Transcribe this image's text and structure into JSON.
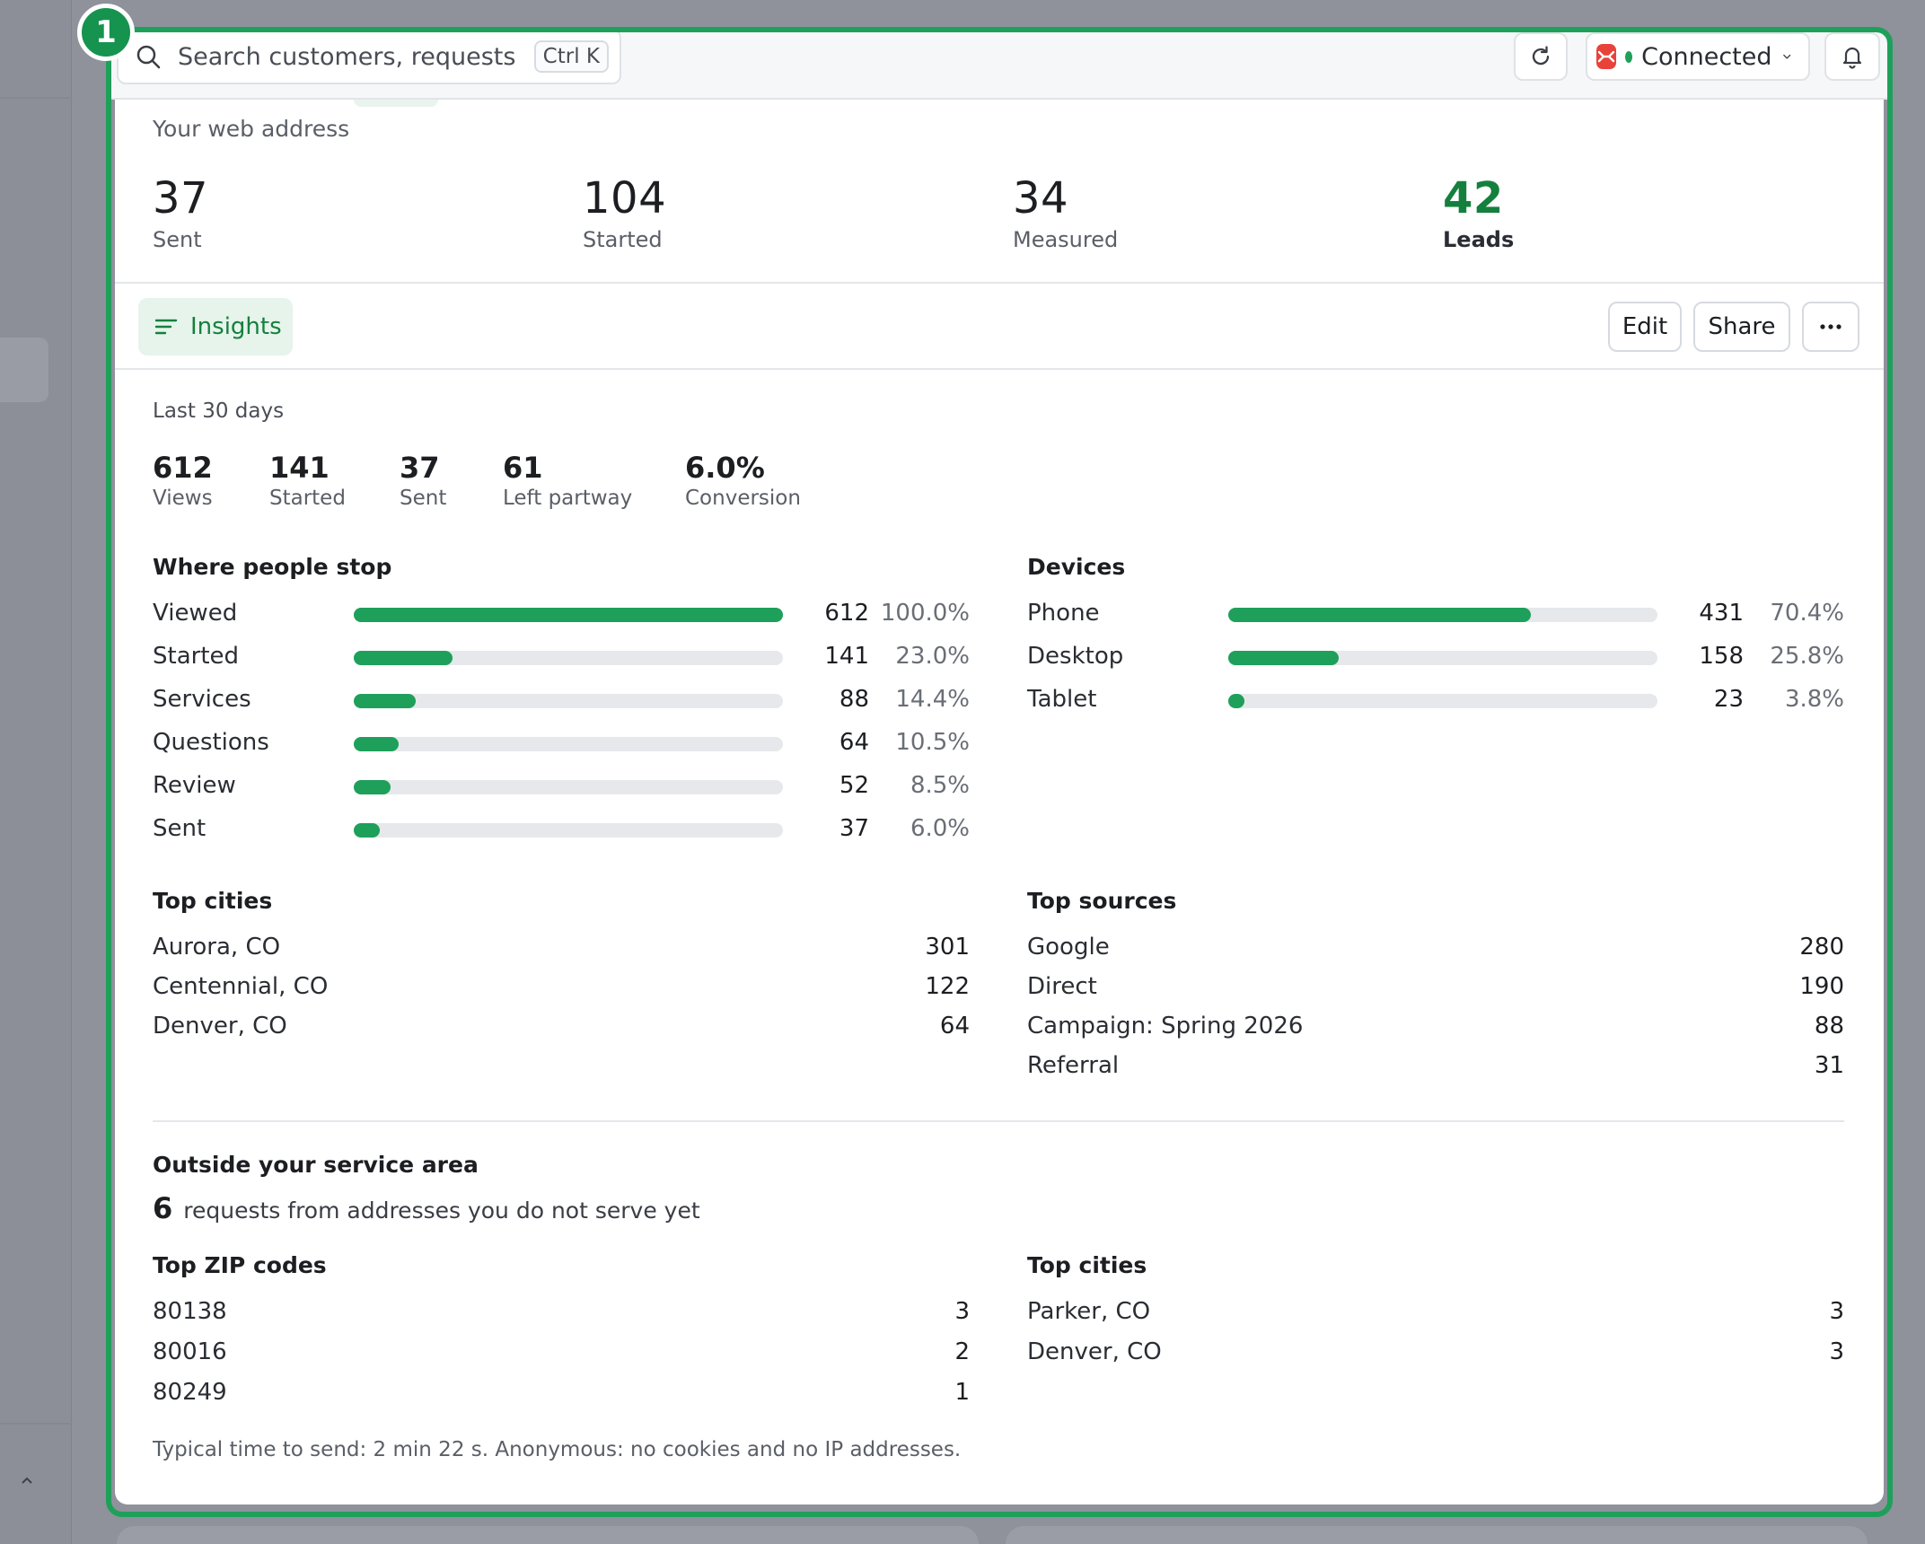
{
  "colors": {
    "accent": "#1ea05a",
    "accent_dark": "#15803d",
    "highlight_frame": "#1ea05a",
    "status_connected": "#1ea05a",
    "integration_logo": "#e8423a"
  },
  "overlay": {
    "badge_number": "1"
  },
  "topbar": {
    "search_placeholder": "Search customers, requests",
    "search_shortcut": "Ctrl K",
    "refresh_icon": "refresh-icon",
    "connection_status": "Connected",
    "bell_icon": "bell-icon"
  },
  "summary": {
    "label": "Your web address",
    "kpis": [
      {
        "value": "37",
        "label": "Sent"
      },
      {
        "value": "104",
        "label": "Started"
      },
      {
        "value": "34",
        "label": "Measured"
      },
      {
        "value": "42",
        "label": "Leads"
      }
    ]
  },
  "tabs": {
    "active": "Insights",
    "edit": "Edit",
    "share": "Share",
    "more": "···"
  },
  "insights": {
    "period": "Last 30 days",
    "stats": [
      {
        "value": "612",
        "label": "Views"
      },
      {
        "value": "141",
        "label": "Started"
      },
      {
        "value": "37",
        "label": "Sent"
      },
      {
        "value": "61",
        "label": "Left partway"
      },
      {
        "value": "6.0%",
        "label": "Conversion"
      }
    ],
    "where_people_stop": {
      "title": "Where people stop",
      "rows": [
        {
          "label": "Viewed",
          "count": "612",
          "pct": "100.0%",
          "fraction": 1.0
        },
        {
          "label": "Started",
          "count": "141",
          "pct": "23.0%",
          "fraction": 0.23
        },
        {
          "label": "Services",
          "count": "88",
          "pct": "14.4%",
          "fraction": 0.144
        },
        {
          "label": "Questions",
          "count": "64",
          "pct": "10.5%",
          "fraction": 0.105
        },
        {
          "label": "Review",
          "count": "52",
          "pct": "8.5%",
          "fraction": 0.085
        },
        {
          "label": "Sent",
          "count": "37",
          "pct": "6.0%",
          "fraction": 0.06
        }
      ]
    },
    "devices": {
      "title": "Devices",
      "rows": [
        {
          "label": "Phone",
          "count": "431",
          "pct": "70.4%",
          "fraction": 0.704
        },
        {
          "label": "Desktop",
          "count": "158",
          "pct": "25.8%",
          "fraction": 0.258
        },
        {
          "label": "Tablet",
          "count": "23",
          "pct": "3.8%",
          "fraction": 0.038
        }
      ]
    },
    "top_cities": {
      "title": "Top cities",
      "rows": [
        {
          "label": "Aurora, CO",
          "value": "301"
        },
        {
          "label": "Centennial, CO",
          "value": "122"
        },
        {
          "label": "Denver, CO",
          "value": "64"
        }
      ]
    },
    "top_sources": {
      "title": "Top sources",
      "rows": [
        {
          "label": "Google",
          "value": "280"
        },
        {
          "label": "Direct",
          "value": "190"
        },
        {
          "label": "Campaign: Spring 2026",
          "value": "88"
        },
        {
          "label": "Referral",
          "value": "31"
        }
      ]
    },
    "outside": {
      "title": "Outside your service area",
      "count": "6",
      "text": "requests from addresses you do not serve yet",
      "zip_title": "Top ZIP codes",
      "zips": [
        {
          "label": "80138",
          "value": "3"
        },
        {
          "label": "80016",
          "value": "2"
        },
        {
          "label": "80249",
          "value": "1"
        }
      ],
      "cities_title": "Top cities",
      "cities": [
        {
          "label": "Parker, CO",
          "value": "3"
        },
        {
          "label": "Denver, CO",
          "value": "3"
        }
      ]
    },
    "footnote": "Typical time to send: 2 min 22 s. Anonymous: no cookies and no IP addresses."
  }
}
